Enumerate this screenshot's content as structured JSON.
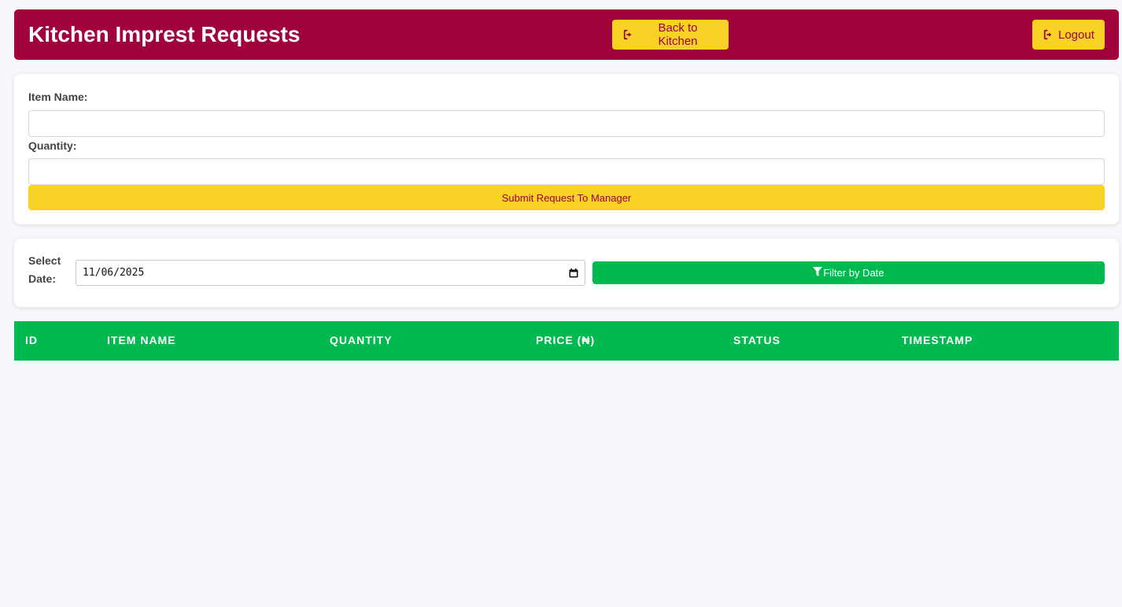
{
  "header": {
    "title": "Kitchen Imprest Requests",
    "back_label": "Back to Kitchen",
    "logout_label": "Logout",
    "icons": {
      "back": "sign-out-icon",
      "logout": "sign-out-icon"
    }
  },
  "form": {
    "item_label": "Item Name:",
    "item_value": "",
    "quantity_label": "Quantity:",
    "quantity_value": "",
    "submit_label": "Submit Request To Manager"
  },
  "filter": {
    "label": "Select Date:",
    "date_value": "11/06/2025",
    "button_label": "Filter by Date",
    "icons": {
      "button": "filter-icon",
      "date": "calendar-icon"
    }
  },
  "table": {
    "columns": [
      "ID",
      "ITEM NAME",
      "QUANTITY",
      "PRICE (₦)",
      "STATUS",
      "TIMESTAMP"
    ],
    "rows": []
  },
  "colors": {
    "brand": "#a0003c",
    "accent": "#f8d325",
    "success": "#00b94f",
    "background": "#f7f8fc"
  }
}
